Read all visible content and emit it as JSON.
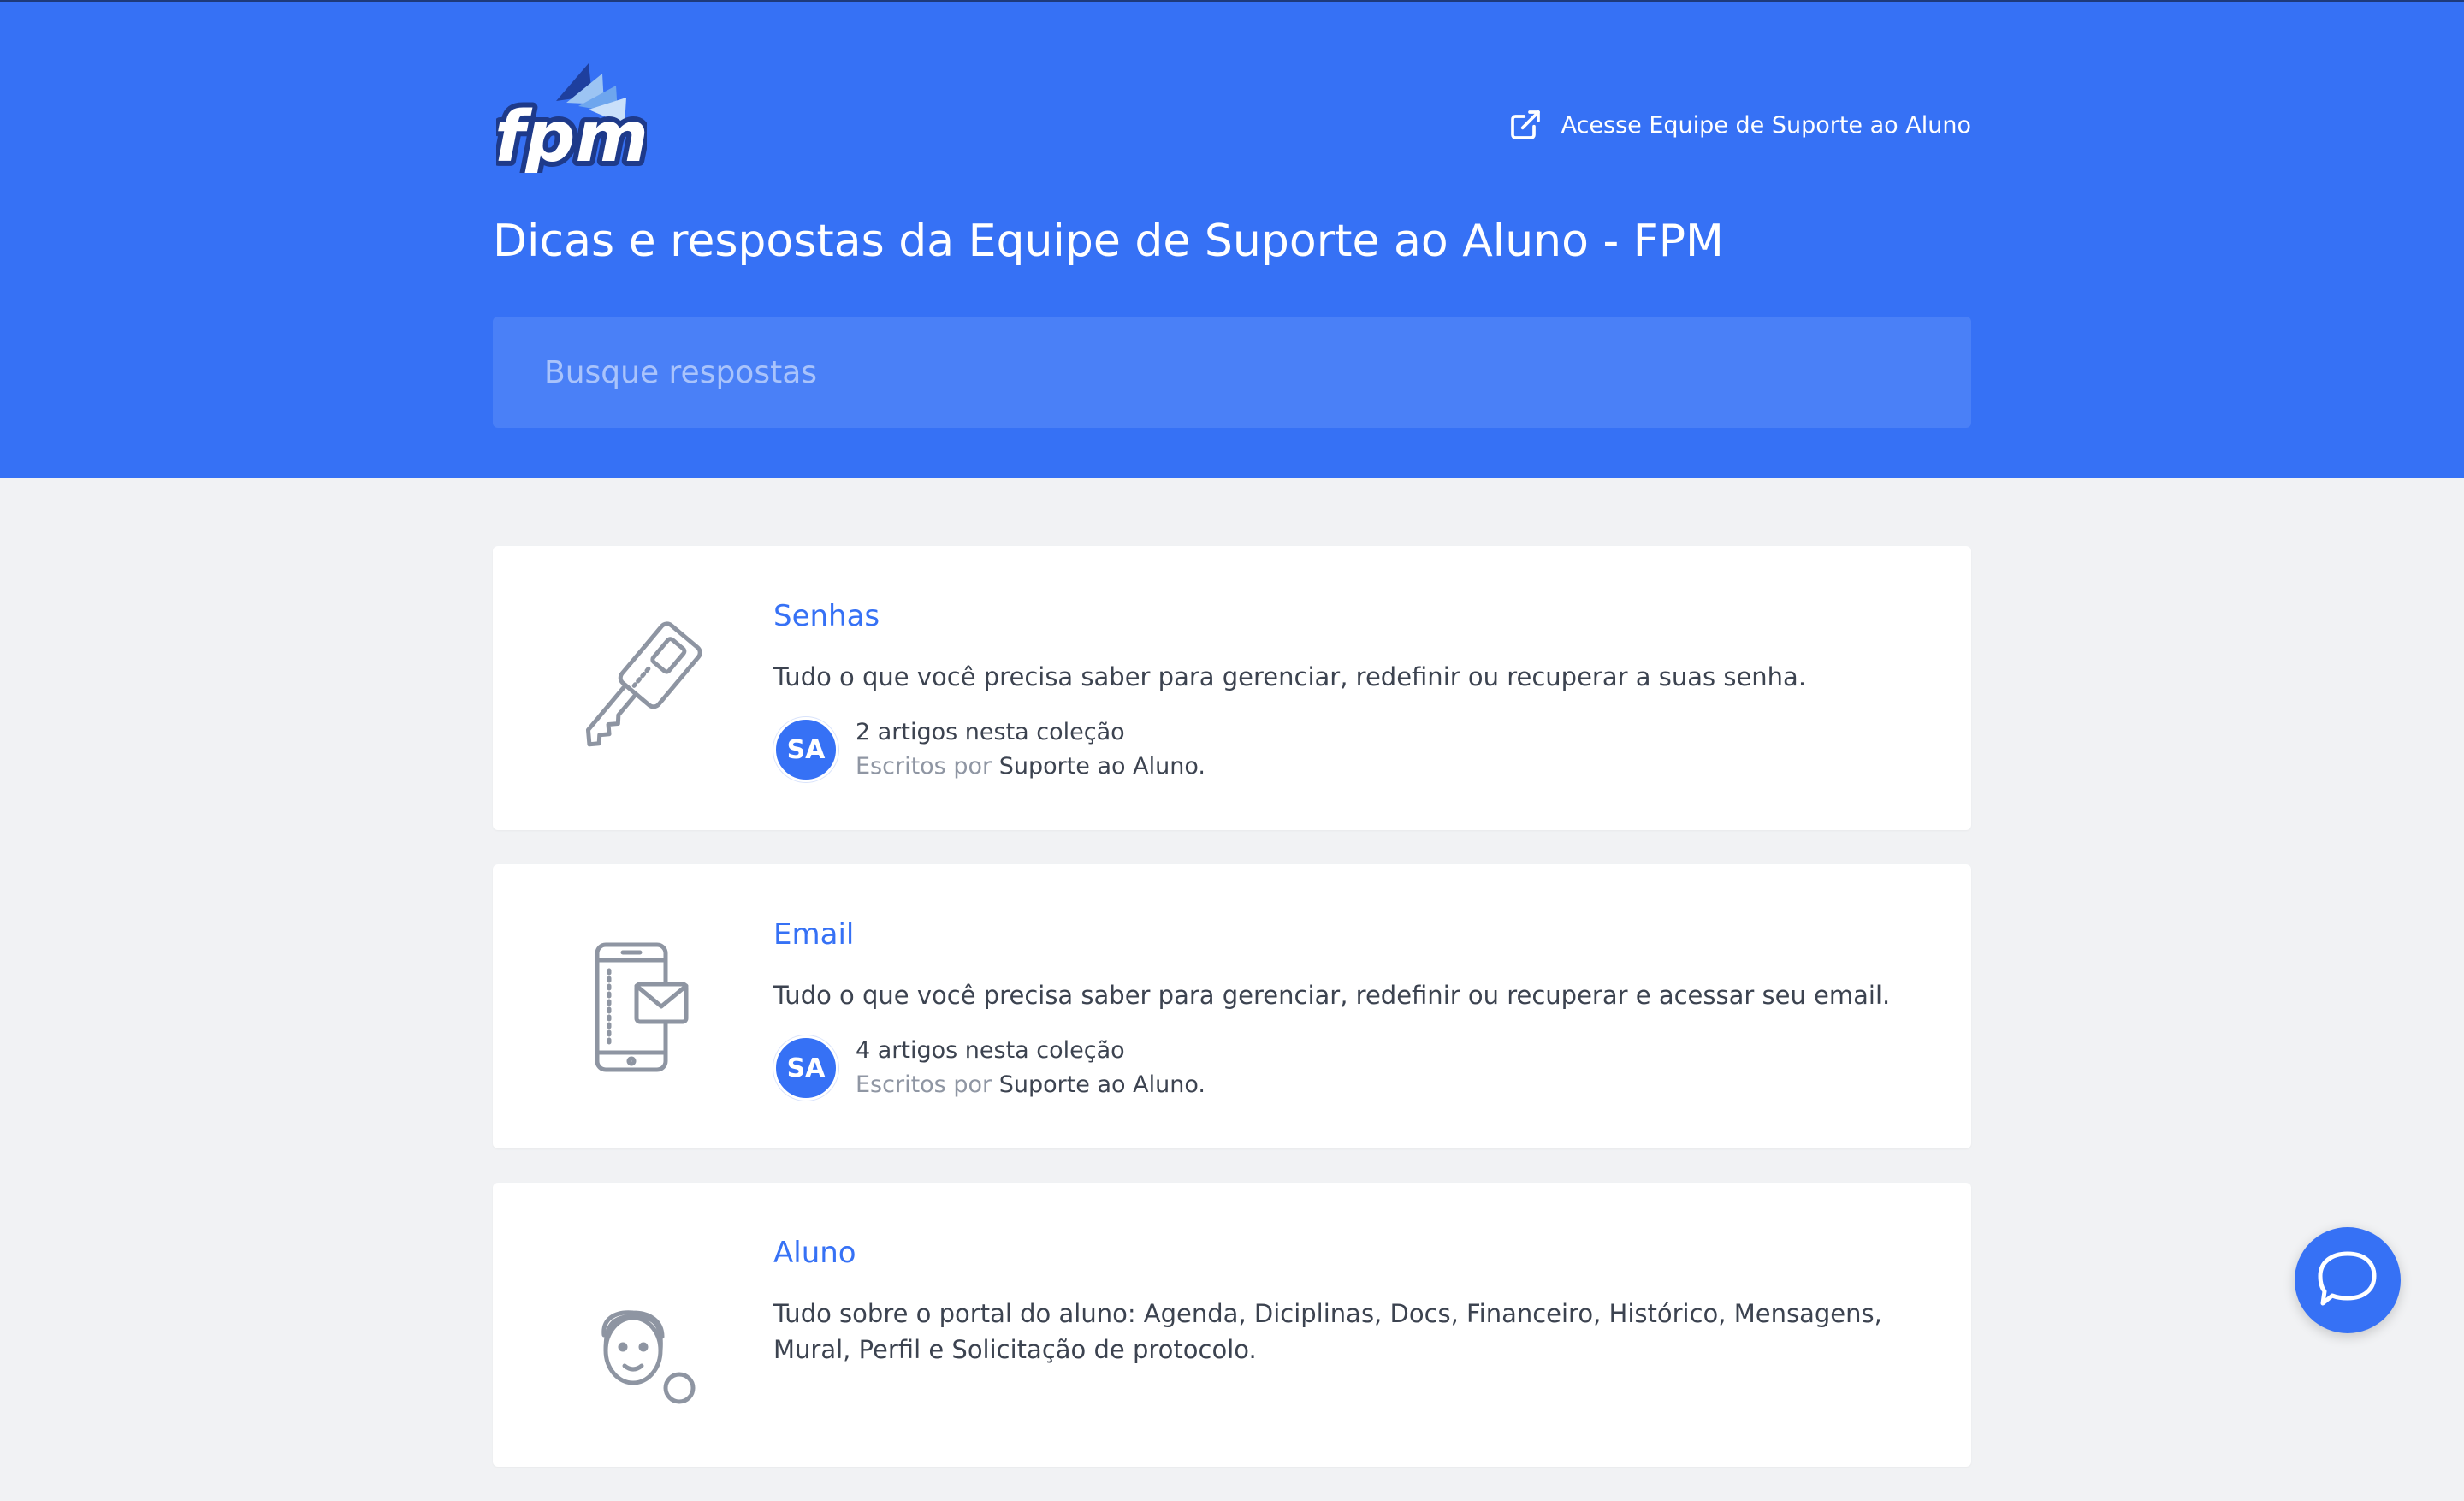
{
  "header": {
    "logo_text": "fpm",
    "external_link_label": "Acesse Equipe de Suporte ao Aluno",
    "title": "Dicas e respostas da Equipe de Suporte ao Aluno - FPM"
  },
  "search": {
    "placeholder": "Busque respostas",
    "value": ""
  },
  "collections": [
    {
      "title": "Senhas",
      "description": "Tudo o que você precisa saber para gerenciar, redefinir ou recuperar a suas senha.",
      "icon": "key-icon",
      "avatar_initials": "SA",
      "article_count": "2 artigos nesta coleção",
      "author_label": "Escritos por",
      "author": "Suporte ao Aluno."
    },
    {
      "title": "Email",
      "description": "Tudo o que você precisa saber para gerenciar, redefinir ou recuperar e acessar seu email.",
      "icon": "phone-email-icon",
      "avatar_initials": "SA",
      "article_count": "4 artigos nesta coleção",
      "author_label": "Escritos por",
      "author": "Suporte ao Aluno."
    },
    {
      "title": "Aluno",
      "description": "Tudo sobre o portal do aluno: Agenda, Diciplinas, Docs, Financeiro, Histórico, Mensagens, Mural, Perfil e Solicitação de protocolo.",
      "icon": "student-icon"
    }
  ],
  "colors": {
    "brand": "#3671f5",
    "page_background": "#f1f2f4",
    "card_background": "#ffffff",
    "text": "#3c4350",
    "muted_text": "#8f96a3"
  },
  "chat": {
    "icon": "chat-bubble-icon"
  }
}
